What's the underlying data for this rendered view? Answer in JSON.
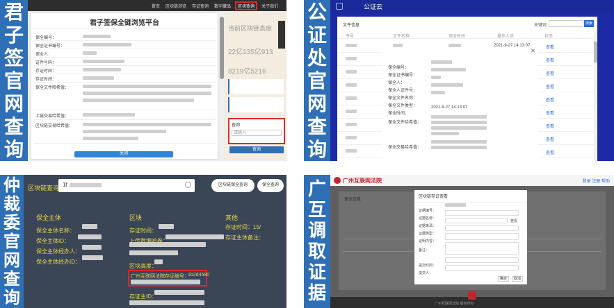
{
  "q1": {
    "side_chars": [
      "君",
      "子",
      "签",
      "官",
      "网",
      "查",
      "询"
    ],
    "title": "君子签保全链浏览平台",
    "nav": [
      "首页",
      "区块链浏览",
      "存证查询",
      "数字藏品",
      "区块查询",
      "关于我们"
    ],
    "nav_active_index": 4,
    "fields": [
      "保全编号：",
      "保全证书编号：",
      "保全人：",
      "证件号码：",
      "存证时间：",
      "保全文件哈希值：",
      "上链交易哈希值：",
      "区块链交易哈希值："
    ],
    "stats_label1": "当前区块链高度",
    "stats_value1": "22亿135亿913",
    "stats_value2": "8219亿5216",
    "query_label": "查询",
    "query_placeholder": "请输入",
    "query_button": "查询",
    "close_button": "关闭",
    "accent": "#2f6fb6"
  },
  "q2": {
    "side_chars": [
      "公",
      "证",
      "处",
      "官",
      "网",
      "查",
      "询"
    ],
    "topbar_title": "公证云",
    "section_title": "文件信息",
    "search_label": "关键词",
    "search_button": "搜索",
    "columns": [
      "序号",
      "文件名称",
      "保全时间",
      "操作人员",
      "状态"
    ],
    "modal_fields": [
      "保全编号：",
      "保全证书编号：",
      "保全人：",
      "保全人证件号：",
      "保全文件名称：",
      "保全文件类型：",
      "保全时间：",
      "保全文件哈希值：",
      "保全交易哈希值："
    ],
    "modal_date": "2021-9-27 14:13:07",
    "link_label": "查看",
    "close_icon": "×",
    "header_bg": "#1a2a9a"
  },
  "q3": {
    "side_chars": [
      "仲",
      "裁",
      "委",
      "官",
      "网",
      "查",
      "询"
    ],
    "search_label": "区块链查询",
    "search_value": "1f",
    "btn_1": "区块链保全查询",
    "btn_2": "保全查询",
    "col1_title": "保全主体",
    "col1_lines": [
      "保全主体名称：",
      "保全主体ID：",
      "保全主体经办人：",
      "保全主体经办ID："
    ],
    "col2_title": "区块",
    "col2_lines": [
      "存证时间：",
      "上传数据哈希：",
      "区块高度：",
      "广州互联网法院存证编号：",
      "存证主ID："
    ],
    "col2_highlight": "广州互联网法院存证编号：",
    "col2_highlight_value": "1b2d4580",
    "col3_title": "其他",
    "col3_lines": [
      "存证时间：15/",
      "存证主体备注："
    ],
    "bg": "#3a4556",
    "label_color": "#e8d84a"
  },
  "q4": {
    "side_chars": [
      "广",
      "互",
      "调",
      "取",
      "证",
      "据"
    ],
    "site_title": "广州互联网法院",
    "nav_right": "登录 注册 帮助",
    "panel_title": "保全信息",
    "modal_title": "区块链存证查看",
    "modal_fields": [
      "证据编号：",
      "证据名称：",
      "证据来源：",
      "证据类型：",
      "证明内容：",
      "备注：",
      "提交时间：",
      "提交人："
    ],
    "confirm": "确定",
    "cancel": "取消",
    "footer": "广州互联网法院 版权所有",
    "header_red": "#c0262d"
  }
}
